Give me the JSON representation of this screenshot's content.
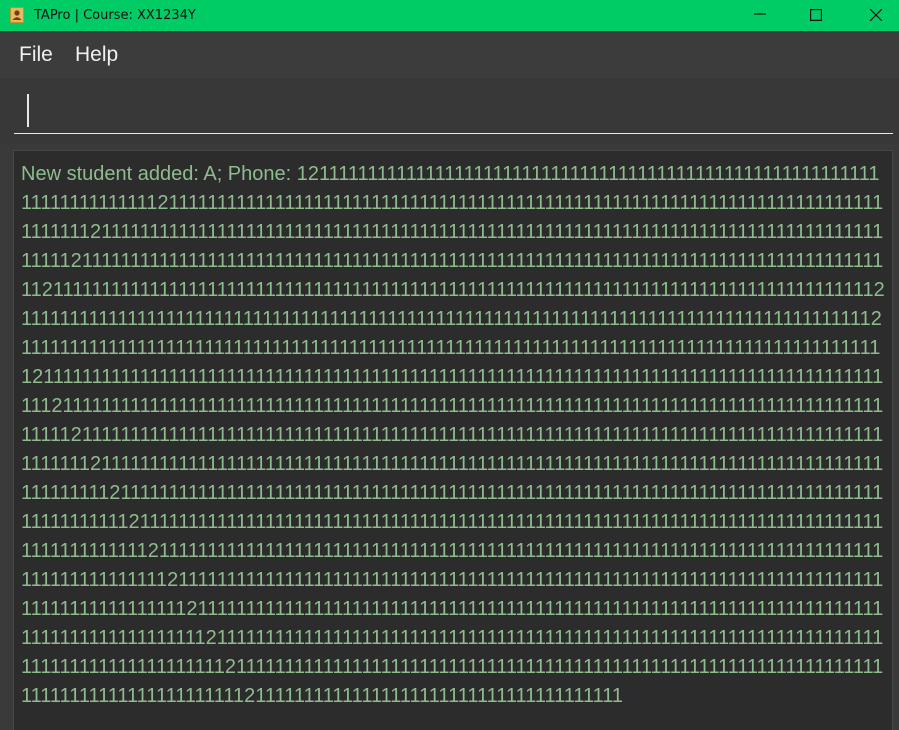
{
  "window": {
    "title": "TAPro | Course: XX1234Y",
    "titlebar_color": "#00cc66",
    "icons": {
      "app": "address-book-icon",
      "minimize": "minimize-icon",
      "maximize": "maximize-icon",
      "close": "close-icon"
    }
  },
  "menubar": {
    "items": [
      {
        "label": "File"
      },
      {
        "label": "Help"
      }
    ]
  },
  "command_box": {
    "value": ""
  },
  "result_display": {
    "text": "New student added: A; Phone: 121111111111111111111111111111111111111111111111111111111111111111111111112111111111111111111111111111111111111111111111111111111111111111111111111111111111211111111111111111111111111111111111111111111111111111111111111111111111111111111111111211111111111111111111111111111111111111111111111111111111111111111111111111111111111112111111111111111111111111111111111111111111111111111111111111111111111111111111111111121111111111111111111111111111111111111111111111111111111111111111111111111111111111111111211111111111111111111111111111111111111111111111111111111111111111111111111111111111111111121111111111111111111111111111111111111111111111111111111111111111111111111111111111111111112111111111111111111111111111111111111111111111111111111111111111111111111111111111111111111211111111111111111111111111111111111111111111111111111111111111111111111111111111111111111121111111111111111111111111111111111111111111111111111111111111111111111111111111111111111112111111111111111111111111111111111111111111111111111111111111111111111111111111111111111111211111111111111111111111111111111111111111111111111111111111111111111111111111111111111111121111111111111111111111111111111111111111111111111111111111111111111111111111111111111111112111111111111111111111111111111111111111111111111111111111111111111111111111111111111111111211111111111111111111111111111111111111111111111111111111111111111111111111111111111111111121111111111111111111111111111111111111111111111111111111111111111111111111111111111111111112111111111111111111111111111111111111111111111111111111111111111111111111111111111111111111211111111111111111111111111111111111111",
    "text_color": "#8fbc8f"
  }
}
